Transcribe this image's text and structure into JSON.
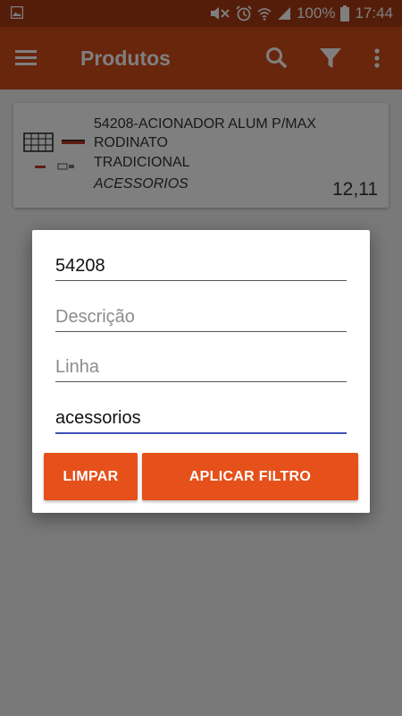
{
  "status_bar": {
    "battery_percent": "100%",
    "time": "17:44",
    "icons": [
      "gallery-icon",
      "mute-icon",
      "alarm-icon",
      "wifi-icon",
      "signal-icon",
      "battery-icon"
    ]
  },
  "app_bar": {
    "title": "Produtos",
    "icons": [
      "menu-icon",
      "search-icon",
      "filter-icon",
      "more-vert-icon"
    ]
  },
  "product": {
    "name": "54208-ACIONADOR ALUM P/MAX RODINATO",
    "line": "TRADICIONAL",
    "category": "ACESSORIOS",
    "price": "12,11"
  },
  "filter_dialog": {
    "code": {
      "value": "54208",
      "placeholder": ""
    },
    "description": {
      "value": "",
      "placeholder": "Descrição"
    },
    "line": {
      "value": "",
      "placeholder": "Linha"
    },
    "category": {
      "value": "acessorios",
      "placeholder": ""
    },
    "clear_label": "LIMPAR",
    "apply_label": "APLICAR FILTRO"
  },
  "colors": {
    "status_bar": "#a83a12",
    "app_bar": "#d04d19",
    "button": "#e6501b",
    "focus_underline": "#3f51b5"
  }
}
